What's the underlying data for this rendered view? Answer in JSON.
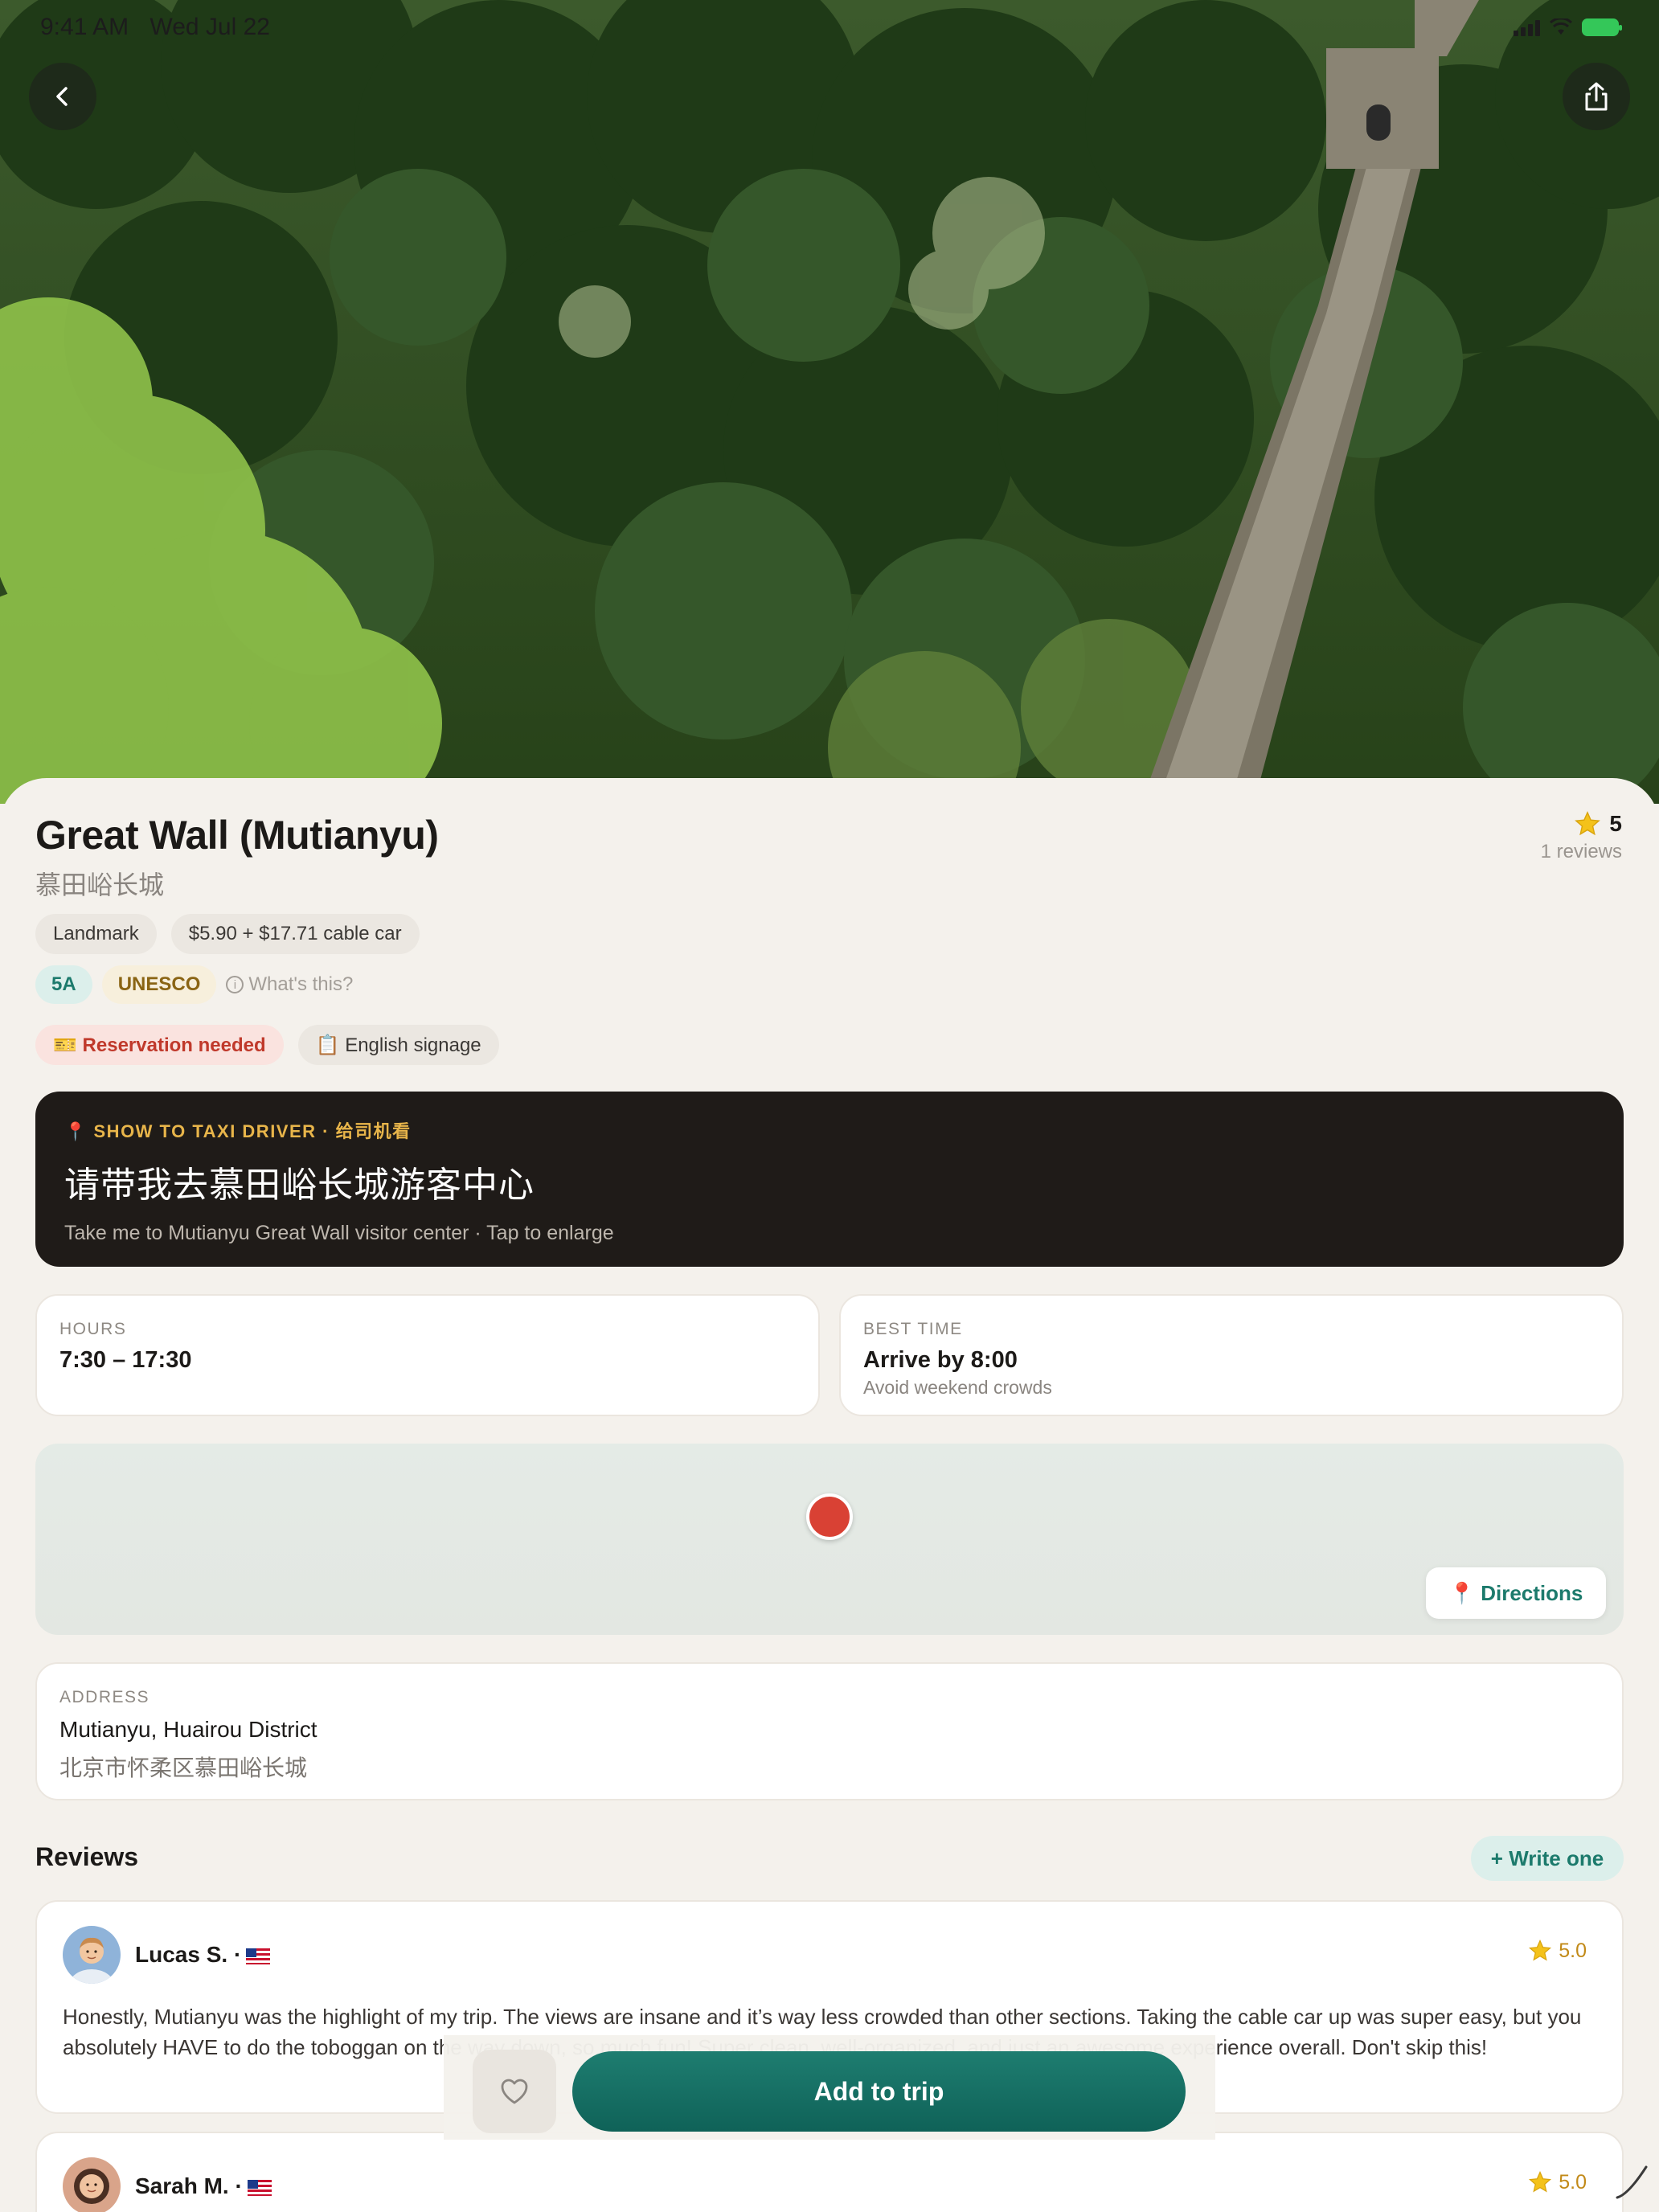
{
  "status_bar": {
    "time": "9:41 AM",
    "date": "Wed Jul 22"
  },
  "hero": {
    "image": "mountain forest with stone wall and staircase"
  },
  "place": {
    "title": "Great Wall (Mutianyu)",
    "subtitle": "慕田峪长城",
    "rating": "5",
    "reviews_count": "1 reviews"
  },
  "chips": {
    "category": "Landmark",
    "price": "$5.90 + $17.71 cable car",
    "grade": "5A",
    "unesco": "UNESCO",
    "whats_this": "What's this?",
    "reservation": "🎫 Reservation needed",
    "signage": "📋 English signage"
  },
  "taxi": {
    "label": "📍 SHOW TO TAXI DRIVER · 给司机看",
    "chinese": "请带我去慕田峪长城游客中心",
    "english": "Take me to Mutianyu Great Wall visitor center · Tap to enlarge"
  },
  "hours": {
    "label": "HOURS",
    "value": "7:30 – 17:30"
  },
  "best_time": {
    "label": "BEST TIME",
    "value": "Arrive by 8:00",
    "note": "Avoid weekend crowds"
  },
  "map": {
    "directions": "📍 Directions"
  },
  "address": {
    "label": "ADDRESS",
    "line1": "Mutianyu, Huairou District",
    "line2": "北京市怀柔区慕田峪长城"
  },
  "reviews": {
    "title": "Reviews",
    "write_button": "+ Write one",
    "items": [
      {
        "name": "Lucas S. ·",
        "rating": "5.0",
        "text": "Honestly, Mutianyu was the highlight of my trip. The views are insane and it’s way less crowded than other sections. Taking the cable car up was super easy, but you absolutely HAVE to do the toboggan on the way down, so much fun! Super clean, well-organized, and just an awesome experience overall. Don't skip this!"
      },
      {
        "name": "Sarah M. ·",
        "rating": "5.0"
      }
    ]
  },
  "actions": {
    "add_to_trip": "Add to trip"
  },
  "colors": {
    "accent": "#1c7a6c",
    "star": "#f4c21a",
    "pin": "#d94134",
    "taxi_bg": "#1f1b18"
  }
}
